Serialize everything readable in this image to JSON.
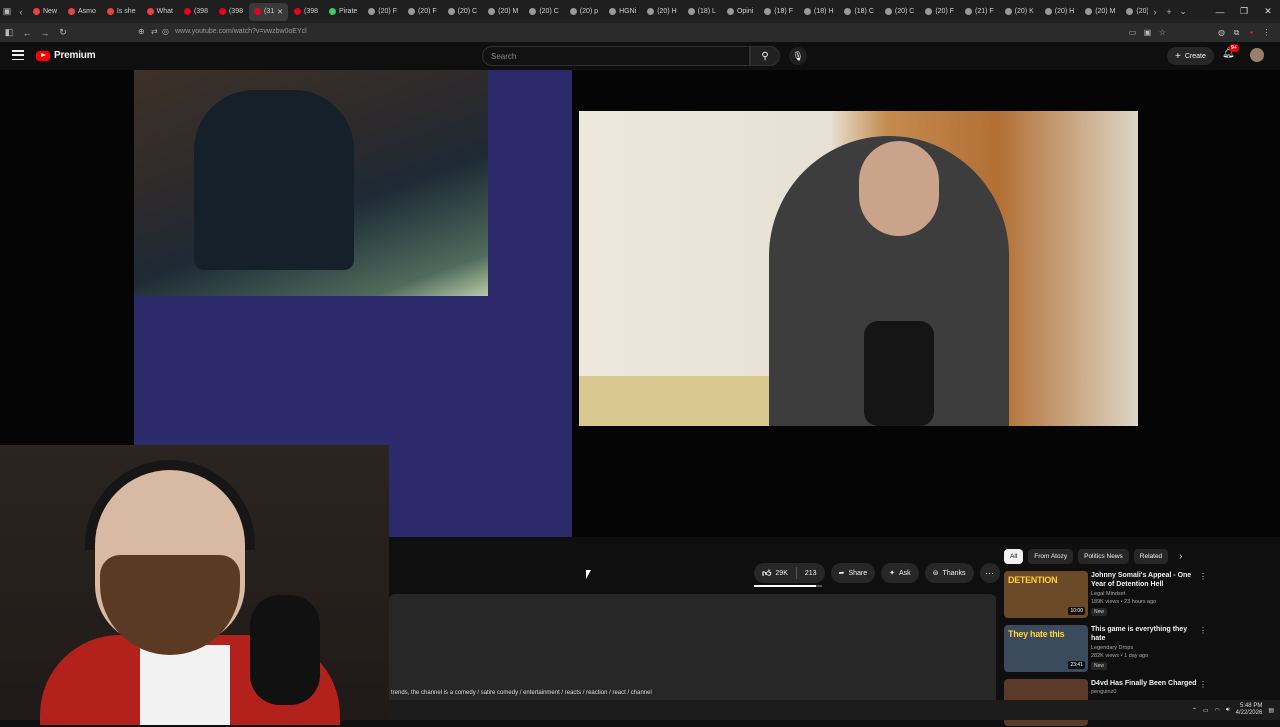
{
  "browser": {
    "tabs": [
      {
        "label": "New",
        "color": "#e8453c"
      },
      {
        "label": "Asmo",
        "color": "#e8453c"
      },
      {
        "label": "Is she",
        "color": "#e8453c"
      },
      {
        "label": "What",
        "color": "#e8453c"
      },
      {
        "label": "(398",
        "color": "#e60023"
      },
      {
        "label": "(398",
        "color": "#e60023"
      },
      {
        "label": "(31",
        "color": "#e60023"
      },
      {
        "label": "(398",
        "color": "#e60023"
      },
      {
        "label": "Pirate",
        "color": "#44c767"
      },
      {
        "label": "(20) F",
        "color": "#999999"
      },
      {
        "label": "(20) F",
        "color": "#999999"
      },
      {
        "label": "(20) C",
        "color": "#999999"
      },
      {
        "label": "(20) M",
        "color": "#999999"
      },
      {
        "label": "(20) C",
        "color": "#999999"
      },
      {
        "label": "(20) p",
        "color": "#999999"
      },
      {
        "label": "HGNi",
        "color": "#999999"
      },
      {
        "label": "(20) H",
        "color": "#999999"
      },
      {
        "label": "(18) L",
        "color": "#999999"
      },
      {
        "label": "Opini",
        "color": "#999999"
      },
      {
        "label": "(18) F",
        "color": "#999999"
      },
      {
        "label": "(18) H",
        "color": "#999999"
      },
      {
        "label": "(18) C",
        "color": "#999999"
      },
      {
        "label": "(20) C",
        "color": "#999999"
      },
      {
        "label": "(20) F",
        "color": "#999999"
      },
      {
        "label": "(21) F",
        "color": "#999999"
      },
      {
        "label": "(20) K",
        "color": "#999999"
      },
      {
        "label": "(20) H",
        "color": "#999999"
      },
      {
        "label": "(20) M",
        "color": "#999999"
      },
      {
        "label": "(20) F",
        "color": "#999999"
      }
    ],
    "url": "www.youtube.com/watch?v=vwzbw0oEYcl"
  },
  "youtube": {
    "logo_label": "Premium",
    "search_placeholder": "Search",
    "create_label": "Create",
    "notif_badge": "9+"
  },
  "actions": {
    "likes": "29K",
    "dislikes": "213",
    "share": "Share",
    "ask": "Ask",
    "thanks": "Thanks"
  },
  "description_tags": "trends, the channel is a comedy / satire comedy / entertainment / reacts / reaction / react / channel",
  "chips": [
    "All",
    "From Atozy",
    "Politics News",
    "Related"
  ],
  "recommendations": [
    {
      "title": "Johnny Somali's Appeal - One Year of Detention Hell",
      "channel": "Legal Mindset",
      "meta": "189K views • 23 hours ago",
      "badge": "New",
      "duration": "10:00",
      "thumb_text": "DETENTION",
      "thumb_color": "#6b4a2a"
    },
    {
      "title": "This game is everything they hate",
      "channel": "Legendary Drops",
      "meta": "282K views • 1 day ago",
      "badge": "New",
      "duration": "23:41",
      "thumb_text": "They hate this",
      "thumb_color": "#3b4a5c"
    },
    {
      "title": "D4vd Has Finally Been Charged",
      "channel": "penguinz0",
      "meta": "",
      "badge": "",
      "duration": "",
      "thumb_text": "",
      "thumb_color": "#5a3b2a"
    }
  ],
  "taskbar": {
    "time": "5:48 PM",
    "date": "4/22/2026"
  }
}
